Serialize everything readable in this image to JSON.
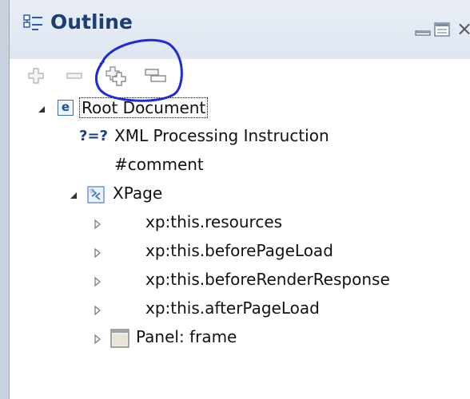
{
  "panel": {
    "title": "Outline",
    "icons": {
      "title": "outline-view-icon",
      "minimize": "minimize-icon",
      "maximize": "maximize-icon",
      "close": "close-icon"
    },
    "close_glyph": "×"
  },
  "toolbar": {
    "buttons": [
      {
        "name": "add-icon"
      },
      {
        "name": "remove-icon"
      },
      {
        "name": "insert-after-icon"
      },
      {
        "name": "insert-child-icon"
      }
    ]
  },
  "tree": {
    "items": [
      {
        "label": "Root Document",
        "icon": "element-icon",
        "icon_text": "e",
        "expanded": true,
        "selected": true
      },
      {
        "label": "XML Processing Instruction",
        "icon": "processing-instruction-icon",
        "icon_text": "?=?"
      },
      {
        "label": "#comment"
      },
      {
        "label": "XPage",
        "icon": "xpage-icon",
        "expanded": true
      },
      {
        "label": "xp:this.resources",
        "collapsed": true
      },
      {
        "label": "xp:this.beforePageLoad",
        "collapsed": true
      },
      {
        "label": "xp:this.beforeRenderResponse",
        "collapsed": true
      },
      {
        "label": "xp:this.afterPageLoad",
        "collapsed": true
      },
      {
        "label": "Panel: frame",
        "icon": "panel-icon",
        "collapsed": true
      }
    ]
  },
  "colors": {
    "title": "#1c3f73",
    "header_bg": "#e4eaf3",
    "annotation": "#1f2bd8"
  }
}
